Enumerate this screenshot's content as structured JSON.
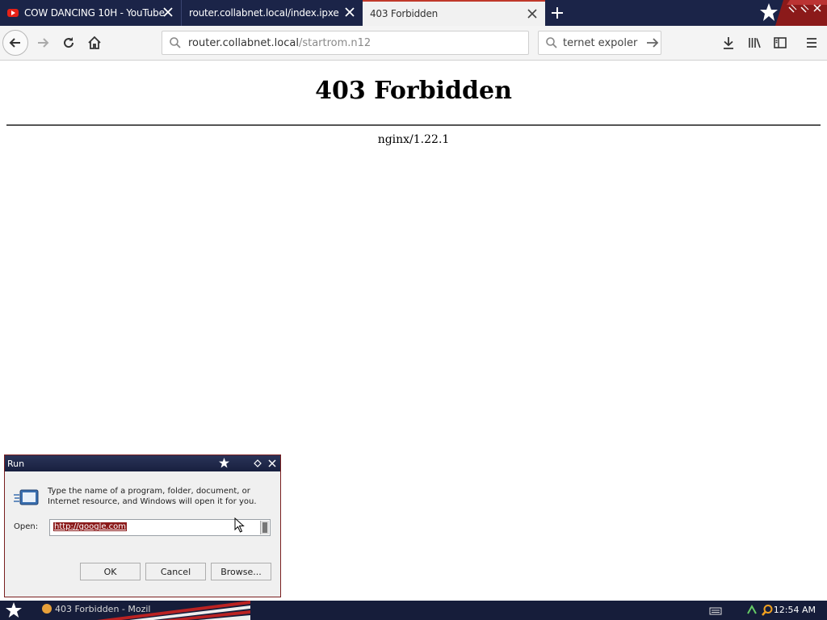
{
  "tabs": [
    {
      "title": "COW DANCING 10H - YouTube",
      "active": false
    },
    {
      "title": "router.collabnet.local/index.ipxe",
      "active": false
    },
    {
      "title": "403 Forbidden",
      "active": true
    }
  ],
  "navbar": {
    "url_host": "router.collabnet.local",
    "url_path": "/startrom.n12",
    "search_text": "ternet expoler c"
  },
  "page": {
    "heading": "403 Forbidden",
    "server": "nginx/1.22.1"
  },
  "run_dialog": {
    "title": "Run",
    "prompt": "Type the name of a program, folder, document, or Internet resource, and Windows will open it for you.",
    "open_label": "Open:",
    "input_value": "http://google.com",
    "ok_label": "OK",
    "cancel_label": "Cancel",
    "browse_label": "Browse..."
  },
  "taskbar": {
    "task_label": "403 Forbidden - Mozil",
    "clock": "12:54 AM"
  },
  "colors": {
    "titlebar": "#1b2448",
    "accent_red": "#8b1a1a",
    "selection": "#8b1a1a"
  },
  "icons": [
    "youtube-icon",
    "close-icon",
    "plus-icon",
    "star-icon",
    "back-icon",
    "forward-icon",
    "reload-icon",
    "home-icon",
    "search-icon",
    "arrow-right-icon",
    "download-icon",
    "library-icon",
    "sidebar-icon",
    "menu-icon",
    "run-icon",
    "cursor-icon",
    "keyboard-icon",
    "network-icon",
    "search-tray-icon"
  ]
}
